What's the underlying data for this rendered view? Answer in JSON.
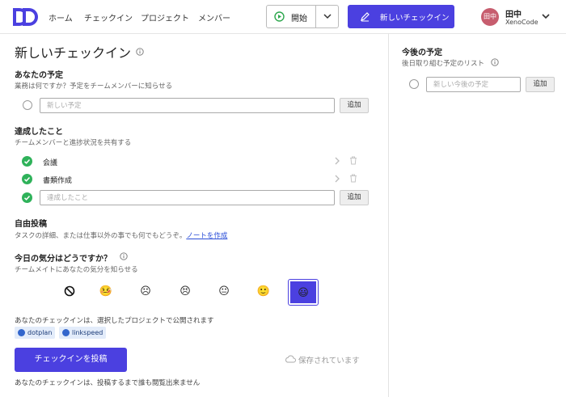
{
  "header": {
    "nav": [
      "ホーム",
      "チェックイン",
      "プロジェクト",
      "メンバー"
    ],
    "start_label": "開始",
    "new_checkin_label": "新しいチェックイン",
    "user": {
      "avatar_text": "田中",
      "name": "田中",
      "org": "XenoCode"
    }
  },
  "main": {
    "title": "新しいチェックイン",
    "plans": {
      "title": "あなたの予定",
      "subtitle": "業務は何ですか？予定をチームメンバーに知らせる",
      "placeholder": "新しい予定",
      "add_label": "追加"
    },
    "done": {
      "title": "達成したこと",
      "subtitle": "チームメンバーと進捗状況を共有する",
      "items": [
        "会議",
        "書類作成"
      ],
      "placeholder": "達成したこと",
      "add_label": "追加"
    },
    "free": {
      "title": "自由投稿",
      "subtitle_before": "タスクの詳細、または仕事以外の事でも何でもどうぞ。",
      "note_link": "ノートを作成"
    },
    "mood": {
      "title": "今日の気分はどうですか？",
      "subtitle": "チームメイトにあなたの気分を知らせる",
      "options": [
        "⃠",
        "🤒",
        "☹",
        "😣",
        "😐",
        "🙂",
        "😃"
      ],
      "selected_index": 6
    },
    "publish_note": "あなたのチェックインは、選択したプロジェクトで公開されます",
    "projects": [
      "dotplan",
      "linkspeed"
    ],
    "submit_label": "チェックインを投稿",
    "saved_label": "保存されています",
    "footer_note": "あなたのチェックインは、投稿するまで誰も閲覧出来ません"
  },
  "upcoming": {
    "title": "今後の予定",
    "subtitle": "後日取り組む予定のリスト",
    "placeholder": "新しい今後の予定",
    "add_label": "追加"
  },
  "colors": {
    "accent": "#4b40e0",
    "check": "#2fb25a",
    "avatar": "#c75d6e"
  }
}
